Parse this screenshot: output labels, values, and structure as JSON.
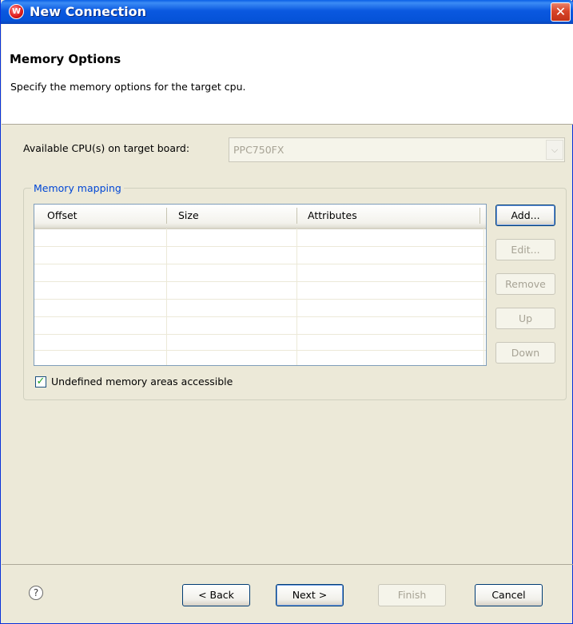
{
  "window": {
    "title": "New Connection",
    "app_icon_glyph": "W",
    "close_glyph": "✕"
  },
  "header": {
    "title": "Memory Options",
    "description": "Specify the memory options for the target cpu."
  },
  "cpu": {
    "label": "Available CPU(s) on target board:",
    "value": "PPC750FX",
    "arrow_glyph": "⌵"
  },
  "memory_mapping": {
    "group_title": "Memory mapping",
    "columns": [
      "Offset",
      "Size",
      "Attributes"
    ],
    "rows": [],
    "buttons": {
      "add": "Add...",
      "edit": "Edit...",
      "remove": "Remove",
      "up": "Up",
      "down": "Down"
    },
    "undefined_accessible_label": "Undefined memory areas accessible",
    "undefined_accessible_checked": true,
    "check_glyph": "✓"
  },
  "footer": {
    "help_glyph": "?",
    "back": "< Back",
    "next": "Next >",
    "finish": "Finish",
    "cancel": "Cancel"
  },
  "colors": {
    "titlebar": "#0a58e0",
    "group_title": "#0046d5",
    "dialog_bg": "#ece9d8",
    "disabled_text": "#a7a395"
  }
}
